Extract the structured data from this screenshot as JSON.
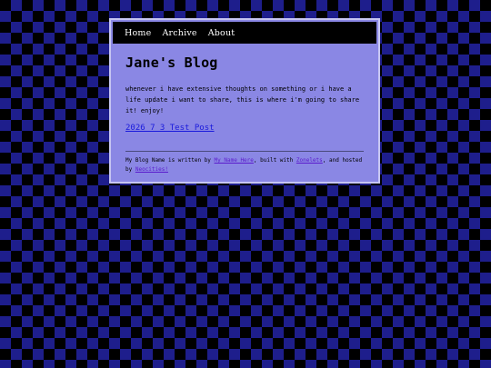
{
  "nav": {
    "items": [
      {
        "label": "Home"
      },
      {
        "label": "Archive"
      },
      {
        "label": "About"
      }
    ]
  },
  "blog": {
    "title": "Jane's Blog",
    "description": "whenever i have extensive thoughts on something or i have a life update i want to share, this is where i'm going to share it! enjoy!",
    "posts": [
      {
        "title": "2026 7 3 Test Post"
      }
    ]
  },
  "footer": {
    "text_1": "My Blog Name is written by ",
    "author_link": "My Name Here",
    "text_2": ", built with ",
    "builder_link": "Zonelets",
    "text_3": ", and hosted by ",
    "host_link": "Neocities!"
  },
  "colors": {
    "panel": "#8a87e4",
    "checker_dark": "#000000",
    "checker_blue": "#1e1e8c",
    "link": "#1a1adc",
    "footer_link": "#5a1acc"
  }
}
